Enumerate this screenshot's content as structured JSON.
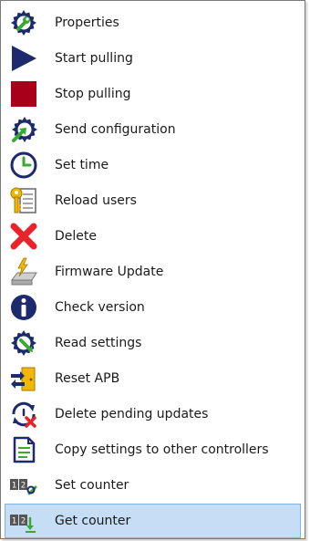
{
  "menu": {
    "items": [
      {
        "label": "Properties",
        "icon": "gear-wrench-icon"
      },
      {
        "label": "Start pulling",
        "icon": "play-icon"
      },
      {
        "label": "Stop pulling",
        "icon": "stop-icon"
      },
      {
        "label": "Send configuration",
        "icon": "gear-arrow-icon"
      },
      {
        "label": "Set time",
        "icon": "clock-icon"
      },
      {
        "label": "Reload users",
        "icon": "key-list-icon"
      },
      {
        "label": "Delete",
        "icon": "red-x-icon"
      },
      {
        "label": "Firmware Update",
        "icon": "firmware-update-icon"
      },
      {
        "label": "Check version",
        "icon": "info-icon"
      },
      {
        "label": "Read settings",
        "icon": "gear-arrow-icon"
      },
      {
        "label": "Reset APB",
        "icon": "reset-apb-icon"
      },
      {
        "label": "Delete pending updates",
        "icon": "delete-pending-icon"
      },
      {
        "label": "Copy settings to other controllers",
        "icon": "document-copy-icon"
      },
      {
        "label": "Set counter",
        "icon": "counter-set-icon"
      },
      {
        "label": "Get counter",
        "icon": "counter-get-icon"
      }
    ],
    "selected_item": "Get counter"
  },
  "colors": {
    "selection_background": "#c5def5",
    "selection_border": "#7fb3e4",
    "navy": "#1e2a6e",
    "green": "#3aaa35",
    "red": "#a8001b"
  }
}
